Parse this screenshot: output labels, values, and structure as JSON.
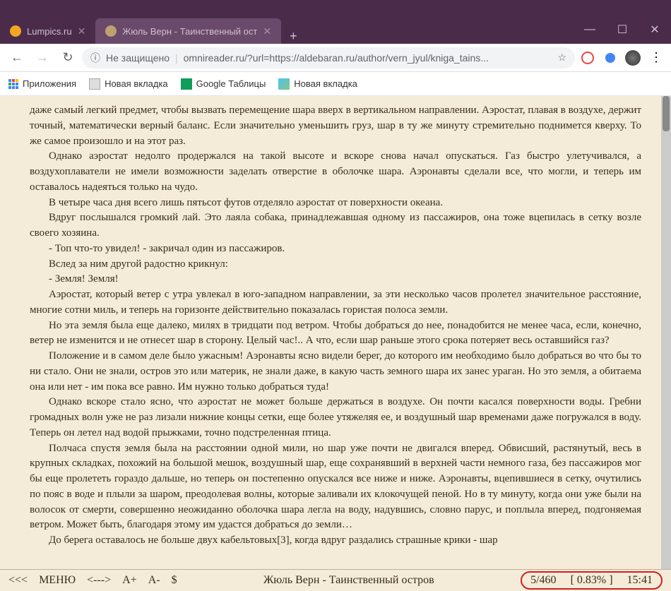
{
  "tabs": [
    {
      "label": "Lumpics.ru",
      "active": false
    },
    {
      "label": "Жюль Верн - Таинственный ост",
      "active": true
    }
  ],
  "window": {
    "min": "—",
    "max": "☐",
    "close": "✕",
    "newtab": "+"
  },
  "nav": {
    "back": "←",
    "forward": "→",
    "reload": "↻"
  },
  "url": {
    "security_label": "Не защищено",
    "security_icon": "ⓘ",
    "text": "omnireader.ru/?url=https://aldebaran.ru/author/vern_jyul/kniga_tains...",
    "star": "☆"
  },
  "menu_dots": "⋮",
  "bookmarks": [
    {
      "label": "Приложения",
      "icon": "apps"
    },
    {
      "label": "Новая вкладка",
      "icon": "doc"
    },
    {
      "label": "Google Таблицы",
      "icon": "sheets"
    },
    {
      "label": "Новая вкладка",
      "icon": "pic"
    }
  ],
  "paragraphs": [
    "даже самый легкий предмет, чтобы вызвать перемещение шара вверх в вертикальном направлении. Аэростат, плавая в воздухе, держит точный, математически верный баланс. Если значительно уменьшить груз, шар в ту же минуту стремительно поднимется кверху. То же самое произошло и на этот раз.",
    "Однако аэростат недолго продержался на такой высоте и вскоре снова начал опускаться. Газ быстро улетучивался, а воздухоплаватели не имели возможности заделать отверстие в оболочке шара. Аэронавты сделали все, что могли, и теперь им оставалось надеяться только на чудо.",
    "В четыре часа дня всего лишь пятьсот футов отделяло аэростат от поверхности океана.",
    "Вдруг послышался громкий лай. Это лаяла собака, принадлежавшая одному из пассажиров, она тоже вцепилась в сетку возле своего хозяина.",
    "- Топ что-то увидел! - закричал один из пассажиров.",
    "Вслед за ним другой радостно крикнул:",
    "- Земля! Земля!",
    "Аэростат, который ветер с утра увлекал в юго-западном направлении, за эти несколько часов пролетел значительное расстояние, многие сотни миль, и теперь на горизонте действительно показалась гористая полоса земли.",
    "Но эта земля была еще далеко, милях в тридцати под ветром. Чтобы добраться до нее, понадобится не менее часа, если, конечно, ветер не изменится и не отнесет шар в сторону. Целый час!.. А что, если шар раньше этого срока потеряет весь оставшийся газ?",
    "Положение и в самом деле было ужасным! Аэронавты ясно видели берег, до которого им необходимо было добраться во что бы то ни стало. Они не знали, остров это или материк, не знали даже, в какую часть земного шара их занес ураган. Но это земля, а обитаема она или нет - им пока все равно. Им нужно только добраться туда!",
    "Однако вскоре стало ясно, что аэростат не может больше держаться в воздухе. Он почти касался поверхности воды. Гребни громадных волн уже не раз лизали нижние концы сетки, еще более утяжеляя ее, и воздушный шар временами даже погружался в воду. Теперь он летел над водой прыжками, точно подстреленная птица.",
    "Полчаса спустя земля была на расстоянии одной мили, но шар уже почти не двигался вперед. Обвисший, растянутый, весь в крупных складках, похожий на большой мешок, воздушный шар, еще сохранявший в верхней части немного газа, без пассажиров мог бы еще пролететь гораздо дальше, но теперь он постепенно опускался все ниже и ниже. Аэронавты, вцепившиеся в сетку, очутились по пояс в воде и плыли за шаром, преодолевая волны, которые заливали их клокочущей пеной. Но в ту минуту, когда они уже были на волосок от смерти, совершенно неожиданно оболочка шара легла на воду, надувшись, словно парус, и поплыла вперед, подгоняемая ветром. Может быть, благодаря этому им удастся добраться до земли…",
    "До берега оставалось не больше двух кабельтовых[3], когда вдруг раздались страшные крики - шар"
  ],
  "bottombar": {
    "prev": "<<<",
    "menu": "МЕНЮ",
    "next": "<--->",
    "font_inc": "A+",
    "font_dec": "A-",
    "style": "$",
    "title": "Жюль Верн - Таинственный остров",
    "page": "5/460",
    "percent": "[ 0.83% ]",
    "time": "15:41"
  }
}
